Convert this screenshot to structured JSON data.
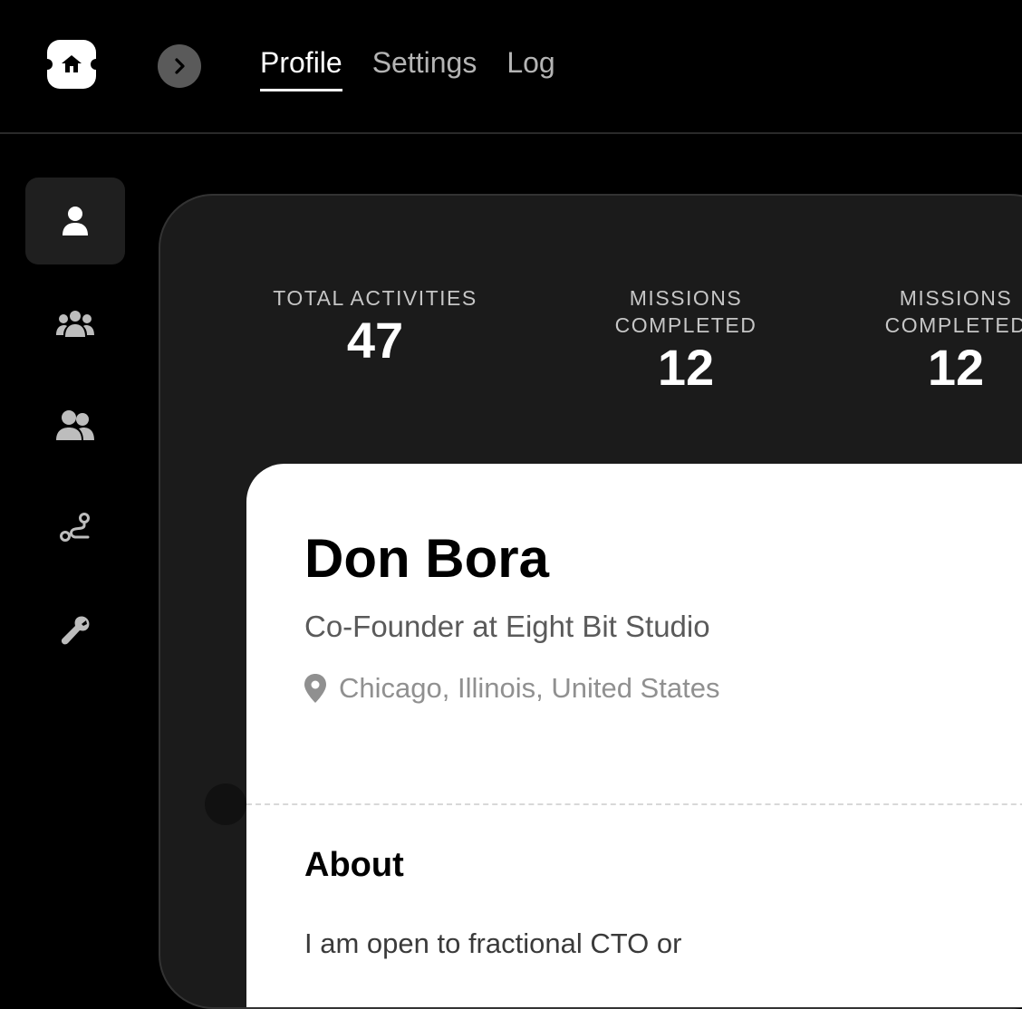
{
  "header": {
    "tabs": [
      {
        "label": "Profile",
        "active": true
      },
      {
        "label": "Settings",
        "active": false
      },
      {
        "label": "Log",
        "active": false
      }
    ]
  },
  "sidebar": {
    "items": [
      {
        "icon": "user-icon",
        "active": true
      },
      {
        "icon": "team-icon",
        "active": false
      },
      {
        "icon": "users-icon",
        "active": false
      },
      {
        "icon": "route-icon",
        "active": false
      },
      {
        "icon": "wrench-icon",
        "active": false
      }
    ]
  },
  "stats": [
    {
      "label": "TOTAL ACTIVITIES",
      "value": "47"
    },
    {
      "label_line1": "MISSIONS",
      "label_line2": "COMPLETED",
      "value": "12"
    }
  ],
  "profile": {
    "name": "Don Bora",
    "role": "Co-Founder at Eight Bit Studio",
    "location": "Chicago, Illinois, United States",
    "about_title": "About",
    "about_text": "I am open to fractional CTO or"
  },
  "colors": {
    "background": "#000000",
    "panel": "#1b1b1b",
    "card": "#ffffff"
  }
}
